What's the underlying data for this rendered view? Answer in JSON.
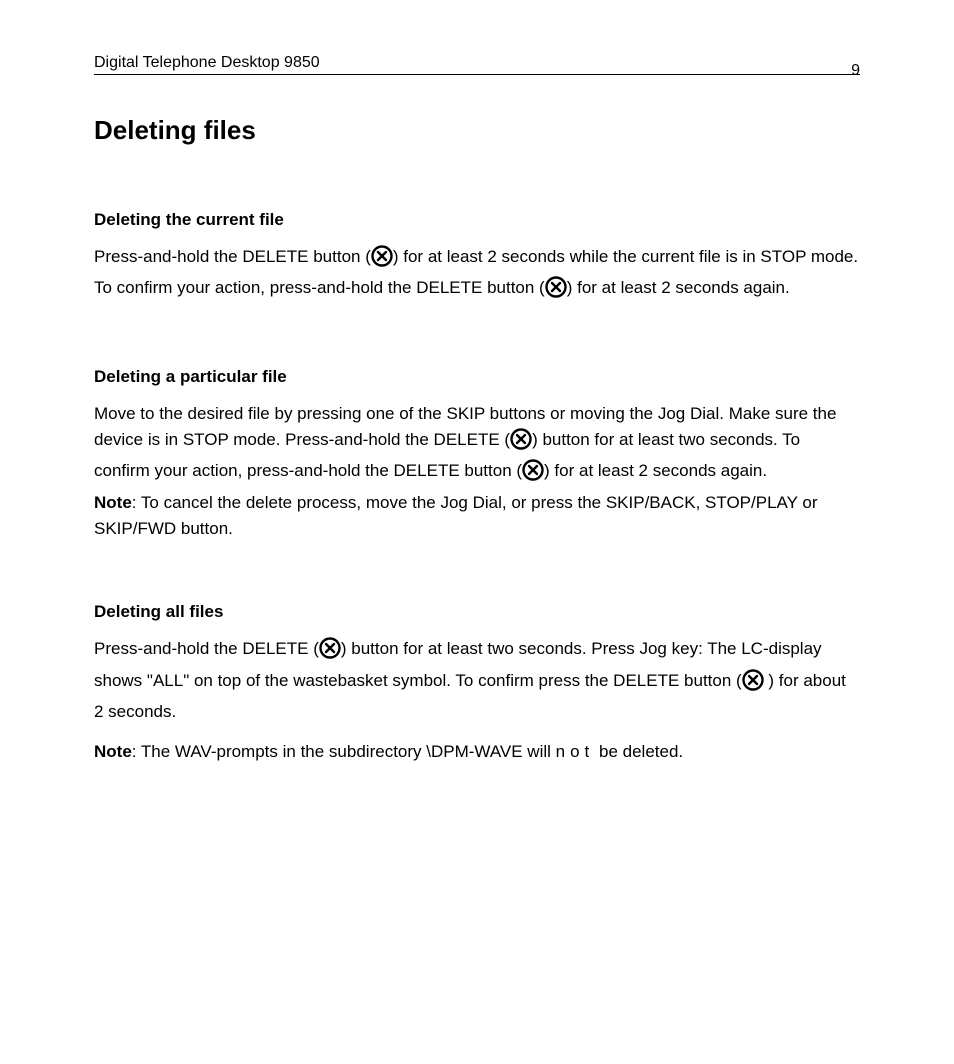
{
  "header": {
    "title": "Digital Telephone Desktop 9850",
    "page_number": "9"
  },
  "main_heading": "Deleting files",
  "sections": [
    {
      "heading": "Deleting the current file",
      "body": {
        "t1": "Press-and-hold the DELETE button (",
        "t2": ") for at least 2 seconds while the current file is in STOP mode. To confirm your action, press-and-hold the DELETE button (",
        "t3": ") for at least 2 seconds again."
      }
    },
    {
      "heading": "Deleting a particular file",
      "body": {
        "t1": "Move to the desired file by pressing one of the SKIP buttons or moving the Jog Dial. Make sure the device is in STOP mode. Press-and-hold the DELETE (",
        "t2": ") button for at least two seconds. To confirm your action, press-and-hold the DELETE button (",
        "t3": ") for at least 2 seconds again.",
        "note_label": "Note",
        "note_body": ": To cancel the delete process, move the Jog Dial, or press the SKIP/BACK, STOP/PLAY or SKIP/FWD button."
      }
    },
    {
      "heading": "Deleting all files",
      "body": {
        "t1": "Press-and-hold the DELETE (",
        "t2": ") button for at least two seconds. Press Jog key: The LC-display shows \"ALL\" on top of the wastebasket symbol. To confirm press the DELETE button (",
        "t3": " ) for about 2 seconds.",
        "note_label": "Note",
        "note_body1": ": The WAV-prompts in the subdirectory \\DPM-WAVE will ",
        "note_emph": "not",
        "note_body2": " be deleted."
      }
    }
  ]
}
